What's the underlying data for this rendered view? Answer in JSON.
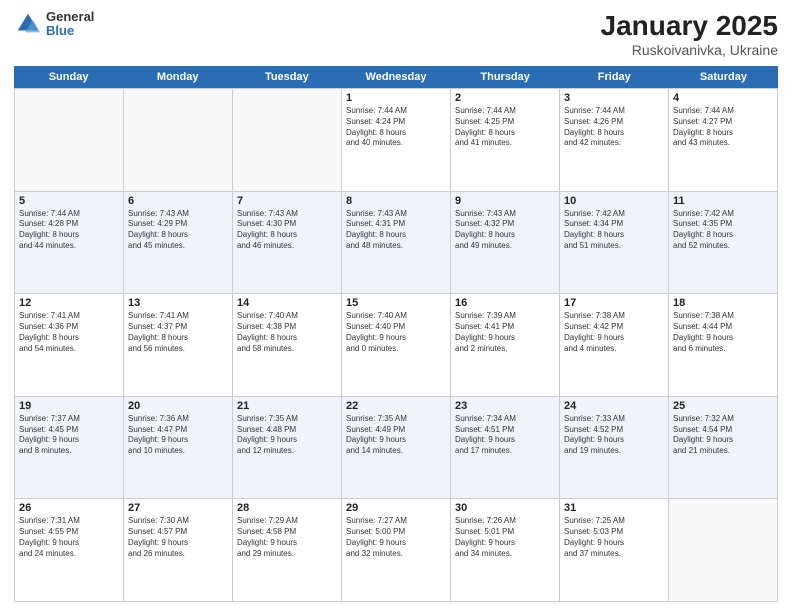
{
  "logo": {
    "general": "General",
    "blue": "Blue"
  },
  "title": {
    "month": "January 2025",
    "location": "Ruskoivanivka, Ukraine"
  },
  "header_days": [
    "Sunday",
    "Monday",
    "Tuesday",
    "Wednesday",
    "Thursday",
    "Friday",
    "Saturday"
  ],
  "weeks": [
    [
      {
        "day": "",
        "info": ""
      },
      {
        "day": "",
        "info": ""
      },
      {
        "day": "",
        "info": ""
      },
      {
        "day": "1",
        "info": "Sunrise: 7:44 AM\nSunset: 4:24 PM\nDaylight: 8 hours\nand 40 minutes."
      },
      {
        "day": "2",
        "info": "Sunrise: 7:44 AM\nSunset: 4:25 PM\nDaylight: 8 hours\nand 41 minutes."
      },
      {
        "day": "3",
        "info": "Sunrise: 7:44 AM\nSunset: 4:26 PM\nDaylight: 8 hours\nand 42 minutes."
      },
      {
        "day": "4",
        "info": "Sunrise: 7:44 AM\nSunset: 4:27 PM\nDaylight: 8 hours\nand 43 minutes."
      }
    ],
    [
      {
        "day": "5",
        "info": "Sunrise: 7:44 AM\nSunset: 4:28 PM\nDaylight: 8 hours\nand 44 minutes."
      },
      {
        "day": "6",
        "info": "Sunrise: 7:43 AM\nSunset: 4:29 PM\nDaylight: 8 hours\nand 45 minutes."
      },
      {
        "day": "7",
        "info": "Sunrise: 7:43 AM\nSunset: 4:30 PM\nDaylight: 8 hours\nand 46 minutes."
      },
      {
        "day": "8",
        "info": "Sunrise: 7:43 AM\nSunset: 4:31 PM\nDaylight: 8 hours\nand 48 minutes."
      },
      {
        "day": "9",
        "info": "Sunrise: 7:43 AM\nSunset: 4:32 PM\nDaylight: 8 hours\nand 49 minutes."
      },
      {
        "day": "10",
        "info": "Sunrise: 7:42 AM\nSunset: 4:34 PM\nDaylight: 8 hours\nand 51 minutes."
      },
      {
        "day": "11",
        "info": "Sunrise: 7:42 AM\nSunset: 4:35 PM\nDaylight: 8 hours\nand 52 minutes."
      }
    ],
    [
      {
        "day": "12",
        "info": "Sunrise: 7:41 AM\nSunset: 4:36 PM\nDaylight: 8 hours\nand 54 minutes."
      },
      {
        "day": "13",
        "info": "Sunrise: 7:41 AM\nSunset: 4:37 PM\nDaylight: 8 hours\nand 56 minutes."
      },
      {
        "day": "14",
        "info": "Sunrise: 7:40 AM\nSunset: 4:38 PM\nDaylight: 8 hours\nand 58 minutes."
      },
      {
        "day": "15",
        "info": "Sunrise: 7:40 AM\nSunset: 4:40 PM\nDaylight: 9 hours\nand 0 minutes."
      },
      {
        "day": "16",
        "info": "Sunrise: 7:39 AM\nSunset: 4:41 PM\nDaylight: 9 hours\nand 2 minutes."
      },
      {
        "day": "17",
        "info": "Sunrise: 7:38 AM\nSunset: 4:42 PM\nDaylight: 9 hours\nand 4 minutes."
      },
      {
        "day": "18",
        "info": "Sunrise: 7:38 AM\nSunset: 4:44 PM\nDaylight: 9 hours\nand 6 minutes."
      }
    ],
    [
      {
        "day": "19",
        "info": "Sunrise: 7:37 AM\nSunset: 4:45 PM\nDaylight: 9 hours\nand 8 minutes."
      },
      {
        "day": "20",
        "info": "Sunrise: 7:36 AM\nSunset: 4:47 PM\nDaylight: 9 hours\nand 10 minutes."
      },
      {
        "day": "21",
        "info": "Sunrise: 7:35 AM\nSunset: 4:48 PM\nDaylight: 9 hours\nand 12 minutes."
      },
      {
        "day": "22",
        "info": "Sunrise: 7:35 AM\nSunset: 4:49 PM\nDaylight: 9 hours\nand 14 minutes."
      },
      {
        "day": "23",
        "info": "Sunrise: 7:34 AM\nSunset: 4:51 PM\nDaylight: 9 hours\nand 17 minutes."
      },
      {
        "day": "24",
        "info": "Sunrise: 7:33 AM\nSunset: 4:52 PM\nDaylight: 9 hours\nand 19 minutes."
      },
      {
        "day": "25",
        "info": "Sunrise: 7:32 AM\nSunset: 4:54 PM\nDaylight: 9 hours\nand 21 minutes."
      }
    ],
    [
      {
        "day": "26",
        "info": "Sunrise: 7:31 AM\nSunset: 4:55 PM\nDaylight: 9 hours\nand 24 minutes."
      },
      {
        "day": "27",
        "info": "Sunrise: 7:30 AM\nSunset: 4:57 PM\nDaylight: 9 hours\nand 26 minutes."
      },
      {
        "day": "28",
        "info": "Sunrise: 7:29 AM\nSunset: 4:58 PM\nDaylight: 9 hours\nand 29 minutes."
      },
      {
        "day": "29",
        "info": "Sunrise: 7:27 AM\nSunset: 5:00 PM\nDaylight: 9 hours\nand 32 minutes."
      },
      {
        "day": "30",
        "info": "Sunrise: 7:26 AM\nSunset: 5:01 PM\nDaylight: 9 hours\nand 34 minutes."
      },
      {
        "day": "31",
        "info": "Sunrise: 7:25 AM\nSunset: 5:03 PM\nDaylight: 9 hours\nand 37 minutes."
      },
      {
        "day": "",
        "info": ""
      }
    ]
  ]
}
